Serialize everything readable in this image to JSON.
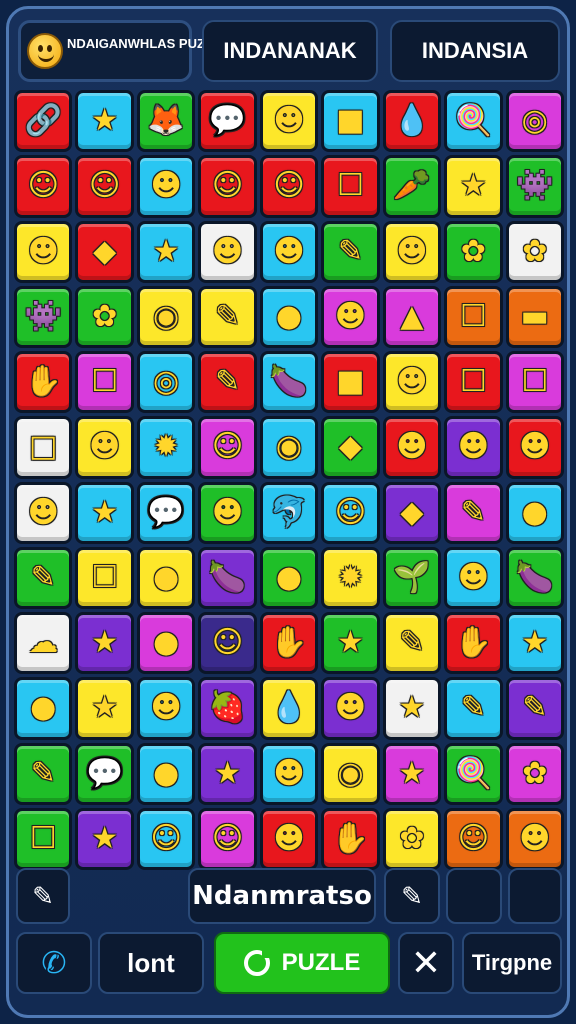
{
  "header": {
    "logo_text": "NDAIGANWHLAS PUZZNEKA",
    "tab_left": "INDANANAK",
    "tab_right": "INDANSIA"
  },
  "board": {
    "rows": [
      [
        {
          "color": "#e8171d",
          "icon": "🔗"
        },
        {
          "color": "#29c6f2",
          "icon": "★"
        },
        {
          "color": "#1fbf28",
          "icon": "🦊"
        },
        {
          "color": "#e8171d",
          "icon": "💬"
        },
        {
          "color": "#fde72a",
          "icon": "☻"
        },
        {
          "color": "#29c6f2",
          "icon": "■"
        },
        {
          "color": "#e8171d",
          "icon": "💧"
        },
        {
          "color": "#29c6f2",
          "icon": "🍭"
        },
        {
          "color": "#d93bdc",
          "icon": "◎"
        }
      ],
      [
        {
          "color": "#e8171d",
          "icon": "☺"
        },
        {
          "color": "#e8171d",
          "icon": "☺"
        },
        {
          "color": "#29c6f2",
          "icon": "☻"
        },
        {
          "color": "#e8171d",
          "icon": "☺"
        },
        {
          "color": "#e8171d",
          "icon": "☺"
        },
        {
          "color": "#e8171d",
          "icon": "☐"
        },
        {
          "color": "#1fbf28",
          "icon": "🥕"
        },
        {
          "color": "#fde72a",
          "icon": "★"
        },
        {
          "color": "#1fbf28",
          "icon": "👾"
        }
      ],
      [
        {
          "color": "#fde72a",
          "icon": "☻"
        },
        {
          "color": "#e8171d",
          "icon": "◆"
        },
        {
          "color": "#29c6f2",
          "icon": "★"
        },
        {
          "color": "#f2f2f2",
          "icon": "☻"
        },
        {
          "color": "#29c6f2",
          "icon": "☻"
        },
        {
          "color": "#1fbf28",
          "icon": "✎"
        },
        {
          "color": "#fde72a",
          "icon": "☻"
        },
        {
          "color": "#1fbf28",
          "icon": "✿"
        },
        {
          "color": "#f2f2f2",
          "icon": "✿"
        }
      ],
      [
        {
          "color": "#1fbf28",
          "icon": "👾"
        },
        {
          "color": "#1fbf28",
          "icon": "✿"
        },
        {
          "color": "#fde72a",
          "icon": "◉"
        },
        {
          "color": "#fde72a",
          "icon": "✎"
        },
        {
          "color": "#29c6f2",
          "icon": "●"
        },
        {
          "color": "#d93bdc",
          "icon": "☻"
        },
        {
          "color": "#d93bdc",
          "icon": "▲"
        },
        {
          "color": "#ec6b12",
          "icon": "☐"
        },
        {
          "color": "#ec6b12",
          "icon": "▬"
        }
      ],
      [
        {
          "color": "#e8171d",
          "icon": "✋"
        },
        {
          "color": "#d93bdc",
          "icon": "☐"
        },
        {
          "color": "#29c6f2",
          "icon": "◎"
        },
        {
          "color": "#e8171d",
          "icon": "✎"
        },
        {
          "color": "#29c6f2",
          "icon": "🍆"
        },
        {
          "color": "#e8171d",
          "icon": "■"
        },
        {
          "color": "#fde72a",
          "icon": "☻"
        },
        {
          "color": "#e8171d",
          "icon": "☐"
        },
        {
          "color": "#d93bdc",
          "icon": "☐"
        }
      ],
      [
        {
          "color": "#f2f2f2",
          "icon": "□"
        },
        {
          "color": "#fde72a",
          "icon": "☻"
        },
        {
          "color": "#29c6f2",
          "icon": "✹"
        },
        {
          "color": "#d93bdc",
          "icon": "☺"
        },
        {
          "color": "#29c6f2",
          "icon": "◉"
        },
        {
          "color": "#1fbf28",
          "icon": "◆"
        },
        {
          "color": "#e8171d",
          "icon": "☻"
        },
        {
          "color": "#7b2fd1",
          "icon": "☻"
        },
        {
          "color": "#e8171d",
          "icon": "☻"
        }
      ],
      [
        {
          "color": "#f2f2f2",
          "icon": "☻"
        },
        {
          "color": "#29c6f2",
          "icon": "★"
        },
        {
          "color": "#29c6f2",
          "icon": "💬"
        },
        {
          "color": "#1fbf28",
          "icon": "☻"
        },
        {
          "color": "#29c6f2",
          "icon": "🐬"
        },
        {
          "color": "#29c6f2",
          "icon": "☺"
        },
        {
          "color": "#7b2fd1",
          "icon": "◆"
        },
        {
          "color": "#d93bdc",
          "icon": "✎"
        },
        {
          "color": "#29c6f2",
          "icon": "●"
        }
      ],
      [
        {
          "color": "#1fbf28",
          "icon": "✎"
        },
        {
          "color": "#fde72a",
          "icon": "☐"
        },
        {
          "color": "#fde72a",
          "icon": "●"
        },
        {
          "color": "#7b2fd1",
          "icon": "🍆"
        },
        {
          "color": "#1fbf28",
          "icon": "●"
        },
        {
          "color": "#fde72a",
          "icon": "✹"
        },
        {
          "color": "#1fbf28",
          "icon": "🌱"
        },
        {
          "color": "#29c6f2",
          "icon": "☻"
        },
        {
          "color": "#1fbf28",
          "icon": "🍆"
        }
      ],
      [
        {
          "color": "#f2f2f2",
          "icon": "☁"
        },
        {
          "color": "#7b2fd1",
          "icon": "★"
        },
        {
          "color": "#d93bdc",
          "icon": "●"
        },
        {
          "color": "#3a2a8c",
          "icon": "☺"
        },
        {
          "color": "#e8171d",
          "icon": "✋"
        },
        {
          "color": "#1fbf28",
          "icon": "★"
        },
        {
          "color": "#fde72a",
          "icon": "✎"
        },
        {
          "color": "#e8171d",
          "icon": "✋"
        },
        {
          "color": "#29c6f2",
          "icon": "★"
        }
      ],
      [
        {
          "color": "#29c6f2",
          "icon": "●"
        },
        {
          "color": "#fde72a",
          "icon": "★"
        },
        {
          "color": "#29c6f2",
          "icon": "☻"
        },
        {
          "color": "#7b2fd1",
          "icon": "🍓"
        },
        {
          "color": "#fde72a",
          "icon": "💧"
        },
        {
          "color": "#7b2fd1",
          "icon": "☻"
        },
        {
          "color": "#f2f2f2",
          "icon": "★"
        },
        {
          "color": "#29c6f2",
          "icon": "✎"
        },
        {
          "color": "#7b2fd1",
          "icon": "✎"
        }
      ],
      [
        {
          "color": "#1fbf28",
          "icon": "✎"
        },
        {
          "color": "#1fbf28",
          "icon": "💬"
        },
        {
          "color": "#29c6f2",
          "icon": "●"
        },
        {
          "color": "#7b2fd1",
          "icon": "★"
        },
        {
          "color": "#29c6f2",
          "icon": "☻"
        },
        {
          "color": "#fde72a",
          "icon": "◉"
        },
        {
          "color": "#d93bdc",
          "icon": "★"
        },
        {
          "color": "#1fbf28",
          "icon": "🍭"
        },
        {
          "color": "#d93bdc",
          "icon": "✿"
        }
      ],
      [
        {
          "color": "#1fbf28",
          "icon": "☐"
        },
        {
          "color": "#7b2fd1",
          "icon": "★"
        },
        {
          "color": "#29c6f2",
          "icon": "☺"
        },
        {
          "color": "#d93bdc",
          "icon": "☺"
        },
        {
          "color": "#e8171d",
          "icon": "☻"
        },
        {
          "color": "#e8171d",
          "icon": "✋"
        },
        {
          "color": "#fde72a",
          "icon": "✿"
        },
        {
          "color": "#ec6b12",
          "icon": "☺"
        },
        {
          "color": "#ec6b12",
          "icon": "☻"
        }
      ]
    ]
  },
  "toolbar": {
    "edit_icon": "✎",
    "center_label": "Ndanmratso",
    "paint_icon": "✎"
  },
  "footer": {
    "call_icon": "✆",
    "font_label": "lont",
    "puzzle_label": "PUZLE",
    "close_icon": "✕",
    "trigger_label": "Tirgpne"
  }
}
